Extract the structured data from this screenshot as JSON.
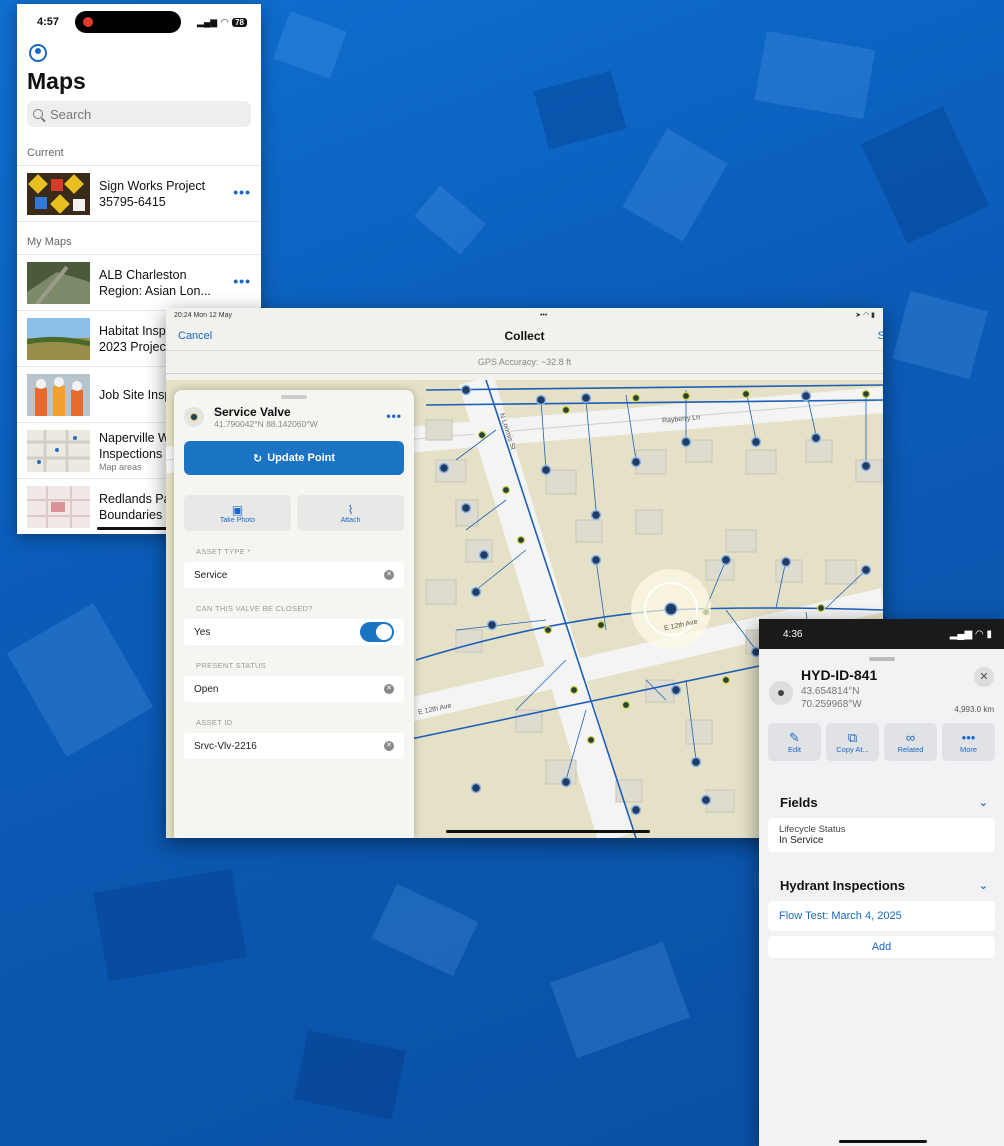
{
  "phone_maps": {
    "status": {
      "time": "4:57",
      "battery": "78"
    },
    "title": "Maps",
    "search_placeholder": "Search",
    "current_label": "Current",
    "current_item": {
      "line1": "Sign Works Project",
      "line2": "35795-6415"
    },
    "mymaps_label": "My Maps",
    "items": [
      {
        "line1": "ALB Charleston",
        "line2": "Region: Asian Lon...",
        "sub": ""
      },
      {
        "line1": "Habitat Insp",
        "line2": "2023 Projec",
        "sub": ""
      },
      {
        "line1": "Job Site Insp",
        "line2": "",
        "sub": ""
      },
      {
        "line1": "Naperville W",
        "line2": "Inspections",
        "sub": "Map areas"
      },
      {
        "line1": "Redlands Pa",
        "line2": "Boundaries",
        "sub": ""
      }
    ]
  },
  "tablet": {
    "status_left": "20:24  Mon 12 May",
    "cancel": "Cancel",
    "title": "Collect",
    "right_action": "S",
    "gps": "GPS Accuracy: ~32.8 ft",
    "street_labels": [
      "Rayberry Ln",
      "N Loomis St",
      "E 12th Ave",
      "E 12th Ave"
    ],
    "panel": {
      "title": "Service Valve",
      "coords": "41.790042°N 88.142060°W",
      "update_button": "Update Point",
      "take_photo": "Take Photo",
      "attach": "Attach",
      "fields": [
        {
          "label": "ASSET TYPE *",
          "value": "Service"
        },
        {
          "label": "CAN THIS VALVE BE CLOSED?",
          "value": "Yes"
        },
        {
          "label": "PRESENT STATUS",
          "value": "Open"
        },
        {
          "label": "ASSET ID",
          "value": "Srvc-Vlv-2216"
        }
      ],
      "toggle_on": true
    }
  },
  "phone_hydrant": {
    "status": {
      "time": "4:36"
    },
    "title": "HYD-ID-841",
    "lat": "43.654814°N",
    "lon": "70.259968°W",
    "distance": "4,993.0 km",
    "actions": [
      "Edit",
      "Copy At...",
      "Related",
      "More"
    ],
    "fields_header": "Fields",
    "lifecycle_label": "Lifecycle Status",
    "lifecycle_value": "In Service",
    "inspections_header": "Hydrant Inspections",
    "inspection_item": "Flow Test: March 4, 2025",
    "add_label": "Add"
  },
  "colors": {
    "accent": "#1968c7",
    "button": "#1b73c4",
    "background": "#0b5cb8"
  }
}
